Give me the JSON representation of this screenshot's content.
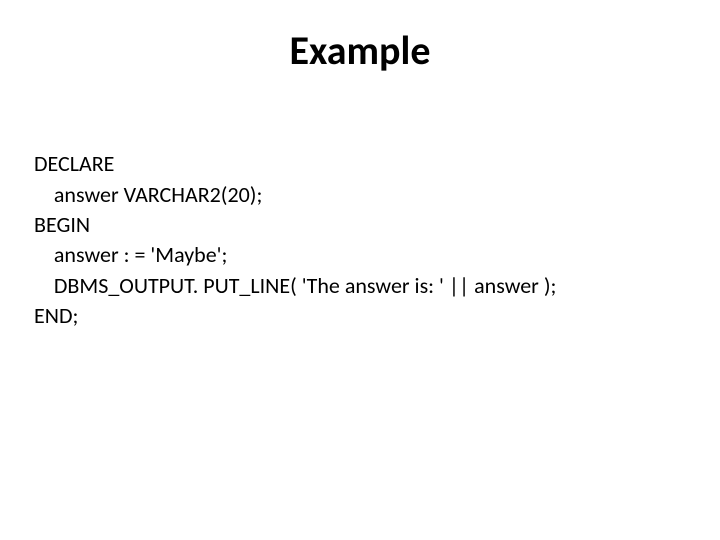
{
  "slide": {
    "title": "Example",
    "code": {
      "line1": "DECLARE",
      "line2": "    answer VARCHAR2(20);",
      "line3": "BEGIN",
      "line4": "    answer : = 'Maybe';",
      "line5": "    DBMS_OUTPUT. PUT_LINE( 'The answer is: ' || answer );",
      "line6": "END;"
    }
  }
}
